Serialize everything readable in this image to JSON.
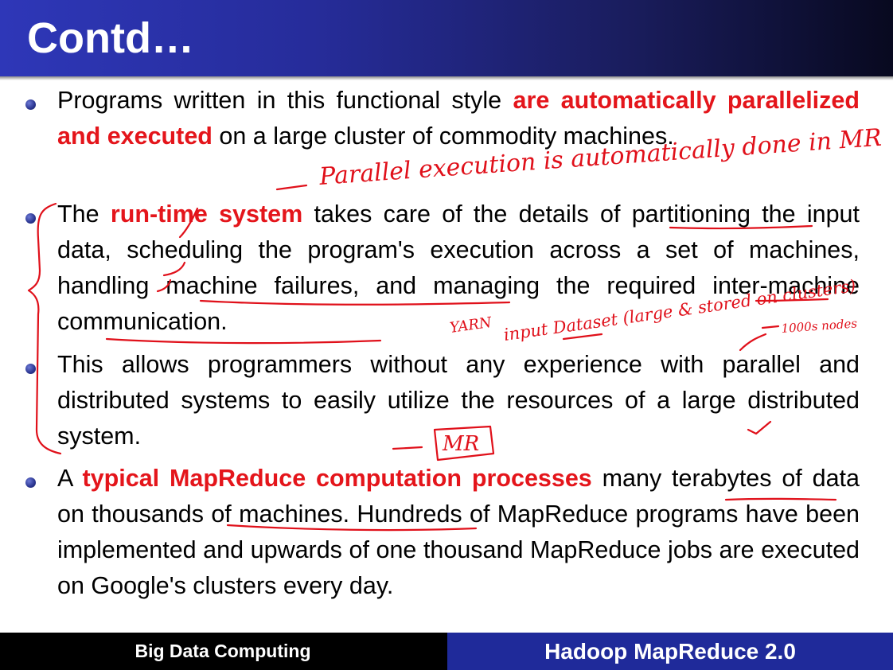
{
  "slide": {
    "title": "Contd…",
    "bullets": [
      {
        "parts": [
          {
            "text": "Programs written in this functional style ",
            "hl": false
          },
          {
            "text": "are automatically parallelized and executed",
            "hl": true
          },
          {
            "text": " on a large cluster of commodity machines.",
            "hl": false
          }
        ]
      },
      {
        "parts": [
          {
            "text": "The ",
            "hl": false
          },
          {
            "text": "run-time system",
            "hl": true
          },
          {
            "text": " takes care of the details of partitioning the input data, scheduling the program's execution across a set of machines, handling machine failures, and managing the required inter-machine communication.",
            "hl": false
          }
        ]
      },
      {
        "parts": [
          {
            "text": "This allows programmers without any experience with parallel and distributed systems to easily utilize the resources of a large distributed system.",
            "hl": false
          }
        ]
      },
      {
        "parts": [
          {
            "text": "A ",
            "hl": false
          },
          {
            "text": "typical MapReduce computation processes",
            "hl": true
          },
          {
            "text": " many terabytes of data on thousands of machines. Hundreds of MapReduce programs have been implemented and upwards of one thousand MapReduce jobs are executed on Google's clusters every day.",
            "hl": false
          }
        ]
      }
    ]
  },
  "annotations": {
    "note1": "Parallel execution is automatically done in MR",
    "note2": "YARN",
    "note3": "input Dataset (large & stored on clusters)",
    "note4": "1000s nodes",
    "note5": "MR"
  },
  "footer": {
    "left": "Big Data Computing",
    "right": "Hadoop MapReduce 2.0"
  },
  "colors": {
    "highlight": "#e4151b",
    "header_blue": "#2e37b8",
    "footer_blue": "#1f2a9a"
  }
}
